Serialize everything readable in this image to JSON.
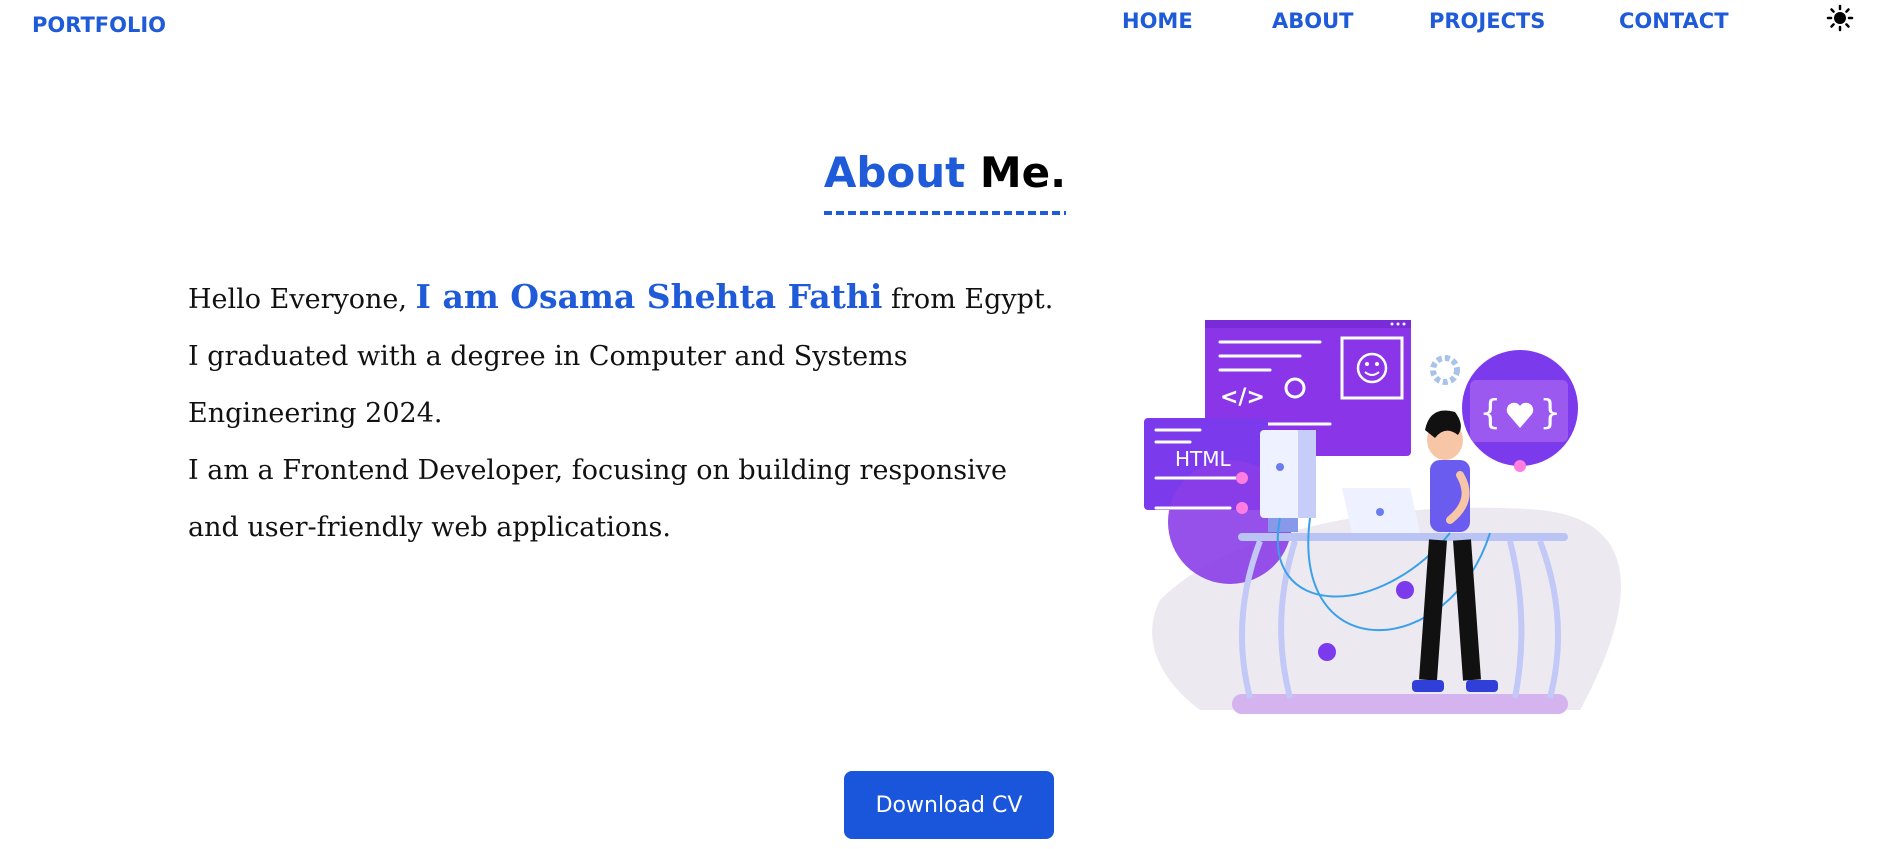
{
  "nav": {
    "logo": "PORTFOLIO",
    "links": [
      {
        "label": "HOME"
      },
      {
        "label": "ABOUT"
      },
      {
        "label": "PROJECTS"
      },
      {
        "label": "CONTACT"
      }
    ],
    "theme_icon": "sun-icon"
  },
  "about": {
    "title_blue": "About",
    "title_black": "Me.",
    "intro_prefix": "Hello Everyone, ",
    "name_highlight": "I am Osama Shehta Fathi",
    "intro_suffix": " from Egypt.",
    "line_graduation": "I graduated with a degree in Computer and Systems Engineering 2024.",
    "line_role": "I am a Frontend Developer, focusing on building responsive and user-friendly web applications."
  },
  "illustration": {
    "html_label": "HTML",
    "icon": "developer-at-desk-illustration"
  },
  "cta": {
    "download_label": "Download CV"
  },
  "colors": {
    "accent": "#1f5bd8",
    "button": "#1a56db",
    "illustration_purple": "#7c3aed"
  }
}
